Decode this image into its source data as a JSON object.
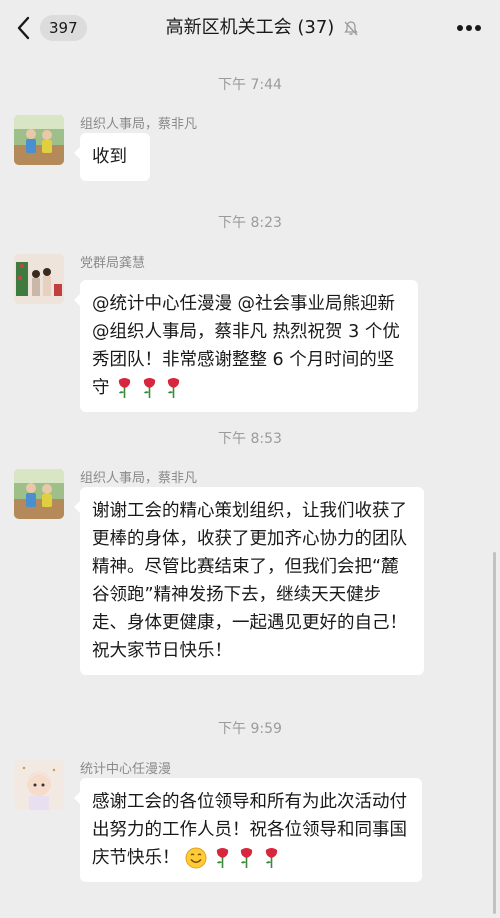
{
  "header": {
    "back_count": "397",
    "title": "高新区机关工会 (37)"
  },
  "messages": [
    {
      "time": "下午 7:44",
      "sender": "组织人事局，蔡非凡",
      "text": "收到",
      "trailing_emoji": []
    },
    {
      "time": "下午 8:23",
      "sender": "党群局龚慧",
      "text": "@统计中心任漫漫 @社会事业局熊迎新 @组织人事局，蔡非凡 热烈祝贺 3 个优秀团队！非常感谢整整 6 个月时间的坚守",
      "trailing_emoji": [
        "rose-emoji",
        "rose-emoji",
        "rose-emoji"
      ]
    },
    {
      "time": "下午 8:53",
      "sender": "组织人事局，蔡非凡",
      "text": "谢谢工会的精心策划组织，让我们收获了更棒的身体，收获了更加齐心协力的团队精神。尽管比赛结束了，但我们会把“麓谷领跑”精神发扬下去，继续天天健步走、身体更健康，一起遇见更好的自己！ 祝大家节日快乐！",
      "trailing_emoji": []
    },
    {
      "time": "下午 9:59",
      "sender": "统计中心任漫漫",
      "text": "感谢工会的各位领导和所有为此次活动付出努力的工作人员！祝各位领导和同事国庆节快乐！",
      "trailing_emoji": [
        "smile-emoji",
        "rose-emoji",
        "rose-emoji",
        "rose-emoji"
      ]
    }
  ],
  "colors": {
    "background": "#ededed",
    "bubble": "#ffffff",
    "timestamp": "#9b9b9b",
    "sender": "#8a8a8a"
  }
}
